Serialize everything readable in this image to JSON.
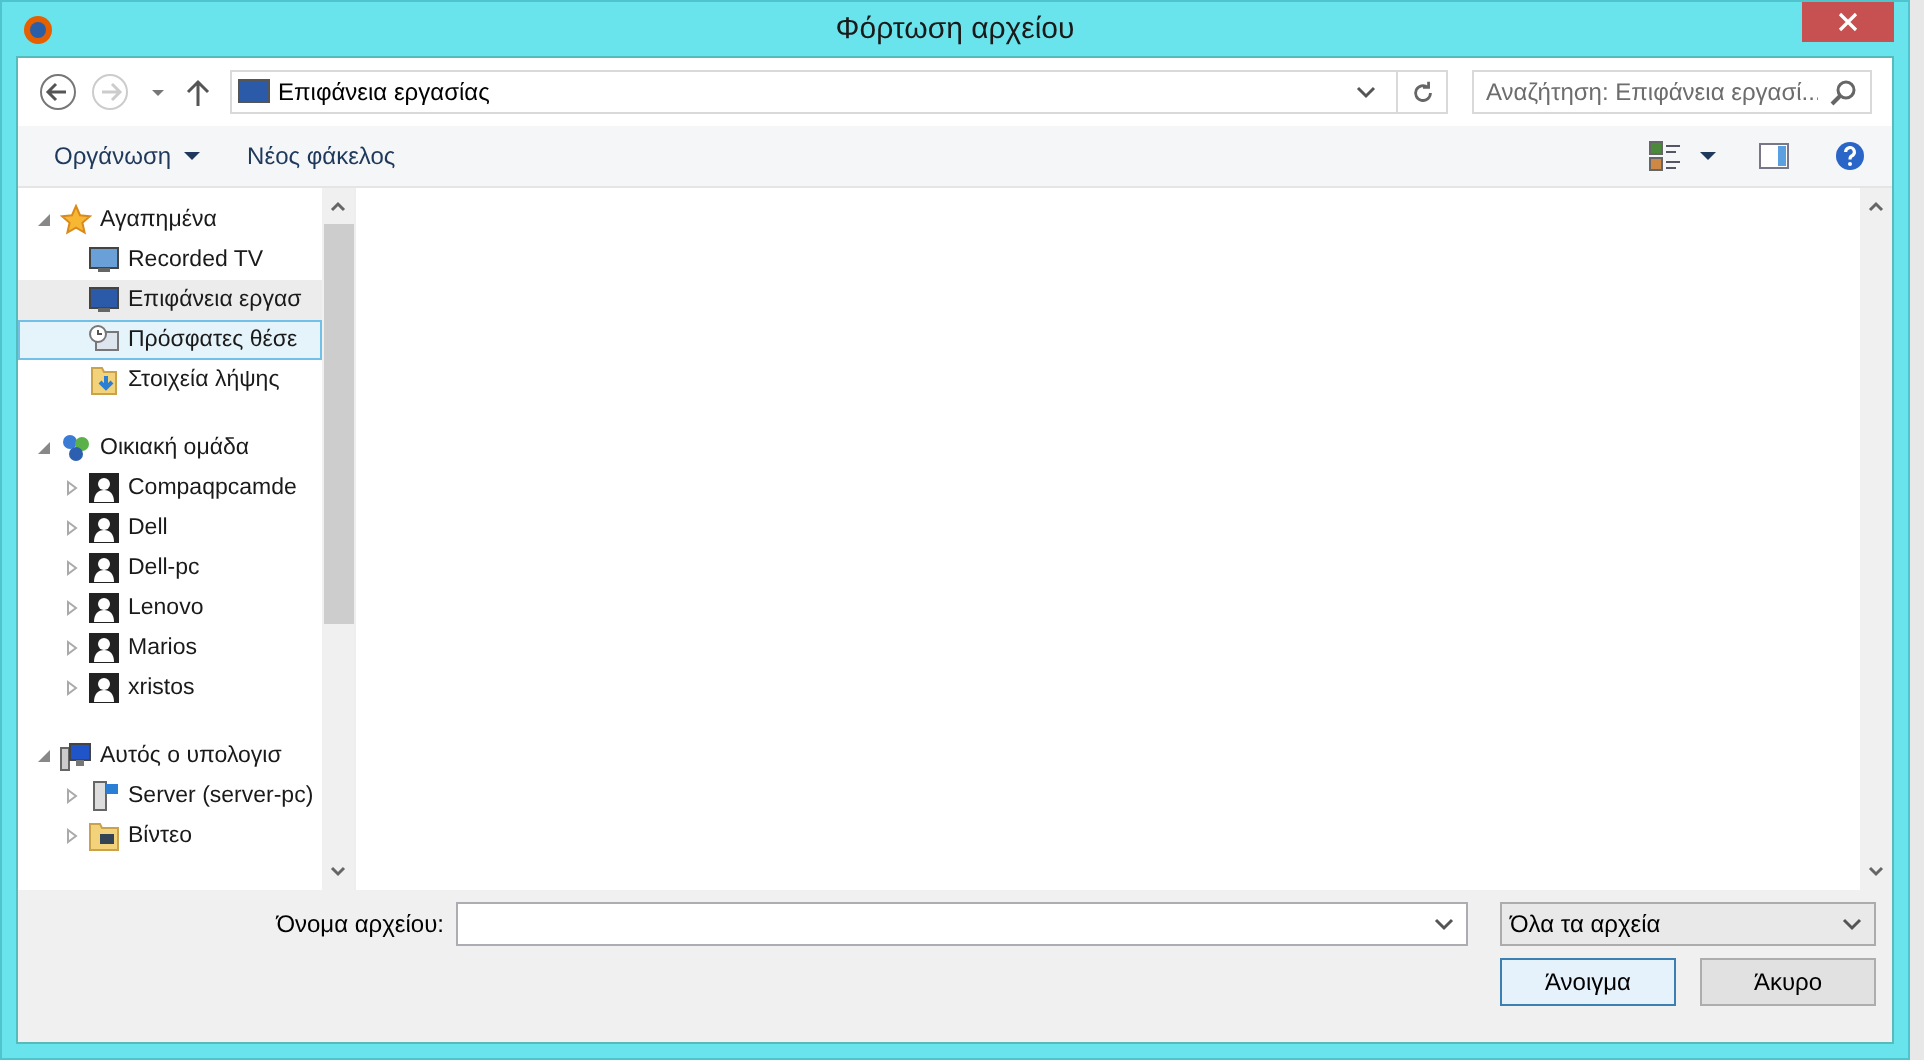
{
  "window": {
    "title": "Φόρτωση αρχείου"
  },
  "address_bar": {
    "path": "Επιφάνεια εργασίας"
  },
  "search": {
    "placeholder": "Αναζήτηση: Επιφάνεια εργασί..."
  },
  "toolbar": {
    "organize": "Οργάνωση",
    "new_folder": "Νέος φάκελος"
  },
  "navigation": [
    {
      "label": "Αγαπημένα",
      "kind": "star",
      "expanded": true,
      "children": [
        {
          "label": "Recorded TV",
          "kind": "monitor",
          "selected": false,
          "hovered": false
        },
        {
          "label": "Επιφάνεια εργασ",
          "kind": "desktop",
          "selected": true,
          "hovered": false
        },
        {
          "label": "Πρόσφατες θέσε",
          "kind": "recent",
          "selected": false,
          "hovered": true
        },
        {
          "label": "Στοιχεία λήψης",
          "kind": "download",
          "selected": false,
          "hovered": false
        }
      ]
    },
    {
      "label": "Οικιακή ομάδα",
      "kind": "homegroup",
      "expanded": true,
      "children": [
        {
          "label": "Compaqpcamde",
          "kind": "user",
          "expanded": false
        },
        {
          "label": "Dell",
          "kind": "user",
          "expanded": false
        },
        {
          "label": "Dell-pc",
          "kind": "user",
          "expanded": false
        },
        {
          "label": "Lenovo",
          "kind": "user",
          "expanded": false
        },
        {
          "label": "Marios",
          "kind": "user",
          "expanded": false
        },
        {
          "label": "xristos",
          "kind": "user",
          "expanded": false
        }
      ]
    },
    {
      "label": "Αυτός ο υπολογισ",
      "kind": "computer",
      "expanded": true,
      "children": [
        {
          "label": "Server (server-pc)",
          "kind": "server",
          "expanded": false
        },
        {
          "label": "Βίντεο",
          "kind": "video",
          "expanded": false
        }
      ]
    }
  ],
  "file_name": {
    "label": "Όνομα αρχείου:"
  },
  "file_type": {
    "value": "Όλα τα αρχεία"
  },
  "buttons": [
    {
      "label": "Άνοιγμα",
      "kind": "default"
    },
    {
      "label": "Άκυρο",
      "kind": "normal"
    }
  ]
}
